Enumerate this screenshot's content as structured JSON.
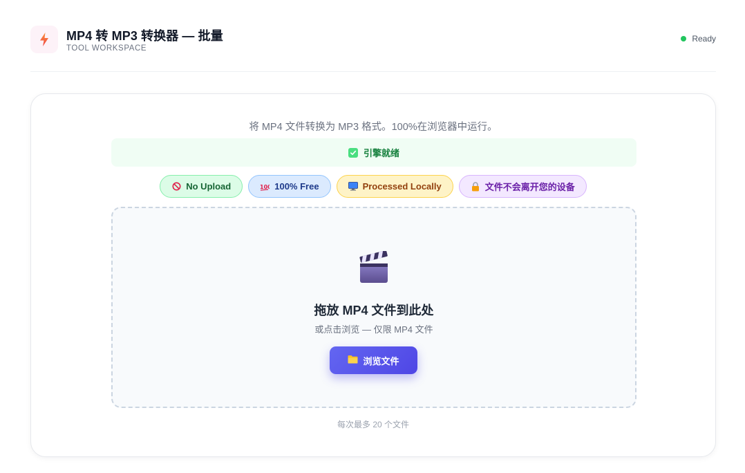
{
  "header": {
    "title": "MP4 转 MP3 转换器 — 批量",
    "subtitle": "TOOL WORKSPACE",
    "status": "Ready",
    "icon": "bolt-icon"
  },
  "main": {
    "description": "将 MP4 文件转换为 MP3 格式。100%在浏览器中运行。",
    "engine_status": "引擎就绪",
    "badges": [
      {
        "label": "No Upload",
        "icon": "no-entry-icon"
      },
      {
        "label": "100% Free",
        "icon": "hundred-icon"
      },
      {
        "label": "Processed Locally",
        "icon": "monitor-icon"
      },
      {
        "label": "文件不会离开您的设备",
        "icon": "lock-icon"
      }
    ],
    "dropzone": {
      "icon": "clapperboard-icon",
      "title": "拖放 MP4 文件到此处",
      "subtitle": "或点击浏览 — 仅限 MP4 文件",
      "browse_label": "浏览文件"
    },
    "limit_note": "每次最多 20 个文件"
  },
  "colors": {
    "accent": "#4f46e5",
    "ready": "#22c55e",
    "engine_text": "#15803d"
  }
}
